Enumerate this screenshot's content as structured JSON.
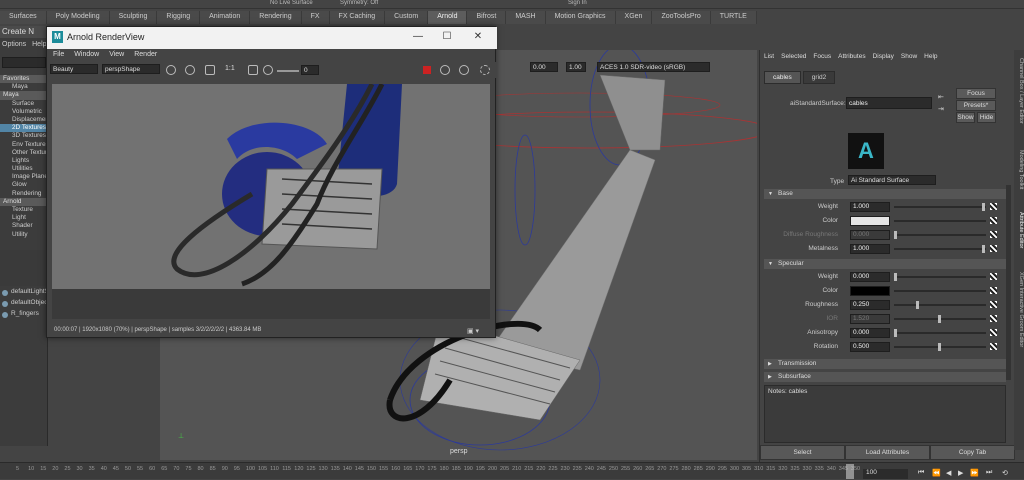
{
  "topbar": {
    "fields": [
      "No Live Surface",
      "Symmetry: Off",
      "Sign In"
    ]
  },
  "shelf": {
    "tabs": [
      "Surfaces",
      "Poly Modeling",
      "Sculpting",
      "Rigging",
      "Animation",
      "Rendering",
      "FX",
      "FX Caching",
      "Custom",
      "Arnold",
      "Bifrost",
      "MASH",
      "Motion Graphics",
      "XGen",
      "ZooToolsPro",
      "TURTLE"
    ],
    "active_index": 9
  },
  "left_panel": {
    "title": "Create N",
    "menu": [
      "Options",
      "Help"
    ],
    "tree": [
      {
        "label": "Favorites",
        "type": "head"
      },
      {
        "label": "Maya",
        "type": "item"
      },
      {
        "label": "Maya",
        "type": "head"
      },
      {
        "label": "Surface",
        "type": "item"
      },
      {
        "label": "Volumetric",
        "type": "item"
      },
      {
        "label": "Displacement",
        "type": "item"
      },
      {
        "label": "2D Textures",
        "type": "selected"
      },
      {
        "label": "3D Textures",
        "type": "item"
      },
      {
        "label": "Env Textures",
        "type": "item"
      },
      {
        "label": "Other Textures",
        "type": "item"
      },
      {
        "label": "Lights",
        "type": "item"
      },
      {
        "label": "Utilities",
        "type": "item"
      },
      {
        "label": "Image Planes",
        "type": "item"
      },
      {
        "label": "Glow",
        "type": "item"
      },
      {
        "label": "Rendering",
        "type": "item"
      },
      {
        "label": "Arnold",
        "type": "head"
      },
      {
        "label": "Texture",
        "type": "item"
      },
      {
        "label": "Light",
        "type": "item"
      },
      {
        "label": "Shader",
        "type": "item"
      },
      {
        "label": "Utility",
        "type": "item"
      }
    ],
    "outliner": [
      "defaultLightSet",
      "defaultObjectSet",
      "R_fingers"
    ]
  },
  "render_view": {
    "title": "Arnold RenderView",
    "menu": [
      "File",
      "Window",
      "View",
      "Render"
    ],
    "aov": "Beauty",
    "camera": "perspShape",
    "ratio": "1:1",
    "exposure": "0",
    "gamma_a": "0.00",
    "gamma_b": "1.00",
    "view_transform": "ACES 1.0 SDR-video (sRGB)",
    "status": "00:00:07 | 1920x1080 (70%) | perspShape | samples 3/2/2/2/2/2 | 4363.84 MB"
  },
  "viewport": {
    "camera_label": "persp"
  },
  "attribute_editor": {
    "menu": [
      "List",
      "Selected",
      "Focus",
      "Attributes",
      "Display",
      "Show",
      "Help"
    ],
    "tabs": [
      "cables",
      "grid2"
    ],
    "node_label": "aiStandardSurface:",
    "node_name": "cables",
    "buttons": {
      "focus": "Focus",
      "presets": "Presets*",
      "show": "Show",
      "hide": "Hide"
    },
    "type_label": "Type",
    "type_value": "Ai Standard Surface",
    "sections": {
      "base": "Base",
      "specular": "Specular",
      "transmission": "Transmission",
      "subsurface": "Subsurface"
    },
    "base_attrs": [
      {
        "label": "Weight",
        "value": "1.000",
        "slider": 1.0,
        "enabled": true
      },
      {
        "label": "Color",
        "value": "",
        "color": "#e6e6e6",
        "enabled": true
      },
      {
        "label": "Diffuse Roughness",
        "value": "0.000",
        "slider": 0.0,
        "enabled": false
      },
      {
        "label": "Metalness",
        "value": "1.000",
        "slider": 1.0,
        "enabled": true
      }
    ],
    "specular_attrs": [
      {
        "label": "Weight",
        "value": "0.000",
        "slider": 0.0,
        "enabled": true
      },
      {
        "label": "Color",
        "value": "",
        "color": "#000000",
        "enabled": true
      },
      {
        "label": "Roughness",
        "value": "0.250",
        "slider": 0.25,
        "enabled": true
      },
      {
        "label": "IOR",
        "value": "1.520",
        "slider": 0.5,
        "enabled": false
      },
      {
        "label": "Anisotropy",
        "value": "0.000",
        "slider": 0.0,
        "enabled": true
      },
      {
        "label": "Rotation",
        "value": "0.500",
        "slider": 0.5,
        "enabled": true
      }
    ],
    "notes": "Notes:  cables",
    "bottom_buttons": [
      "Select",
      "Load Attributes",
      "Copy Tab"
    ]
  },
  "side_tabs": [
    "Channel Box / Layer Editor",
    "Modeling Toolkit",
    "Attribute Editor",
    "XGen Interactive Groom Editor"
  ],
  "timeline": {
    "ticks": [
      "5",
      "10",
      "15",
      "20",
      "25",
      "30",
      "35",
      "40",
      "45",
      "50",
      "55",
      "60",
      "65",
      "70",
      "75",
      "80",
      "85",
      "90",
      "95",
      "100",
      "105",
      "110",
      "115",
      "120",
      "125",
      "130",
      "135",
      "140",
      "145",
      "150",
      "155",
      "160",
      "165",
      "170",
      "175",
      "180",
      "185",
      "190",
      "195",
      "200",
      "205",
      "210",
      "215",
      "220",
      "225",
      "230",
      "235",
      "240",
      "245",
      "250",
      "255",
      "260",
      "265",
      "270",
      "275",
      "280",
      "285",
      "290",
      "295",
      "300",
      "305",
      "310",
      "315",
      "320",
      "325",
      "330",
      "335",
      "340",
      "345",
      "350"
    ],
    "current": "100"
  }
}
